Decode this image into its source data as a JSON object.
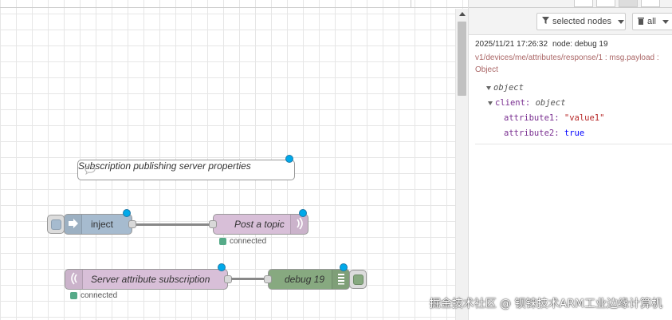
{
  "workspace": {
    "nodes": {
      "comment": {
        "label": "Subscription publishing server properties"
      },
      "inject": {
        "label": "inject"
      },
      "post_topic": {
        "label": "Post a topic",
        "status": "connected"
      },
      "server_sub": {
        "label": "Server attribute subscription",
        "status": "connected"
      },
      "debug": {
        "label": "debug 19"
      }
    },
    "colors": {
      "inject": "#a6bbcf",
      "mqtt": "#d8bfd8",
      "debug": "#87a980",
      "changed_marker": "#00a9ea",
      "status_connected": "#55aa88"
    }
  },
  "sidebar": {
    "filter_button": {
      "label": "selected nodes"
    },
    "clear_button": {
      "label": "all"
    },
    "message": {
      "timestamp": "2025/11/21 17:26:32",
      "node": "node: debug 19",
      "topic": "v1/devices/me/attributes/response/1 : msg.payload : Object",
      "root_type": "object",
      "client_key": "client:",
      "client_type": "object",
      "attr1_key": "attribute1:",
      "attr1_val": "\"value1\"",
      "attr2_key": "attribute2:",
      "attr2_val": "true"
    }
  },
  "watermark": "掘金技术社区 @ 钡铼技术ARM工业边缘计算机",
  "icons": [
    "arrow-right-icon",
    "wave-icon",
    "list-icon",
    "comment-icon",
    "filter-icon",
    "trash-icon"
  ]
}
